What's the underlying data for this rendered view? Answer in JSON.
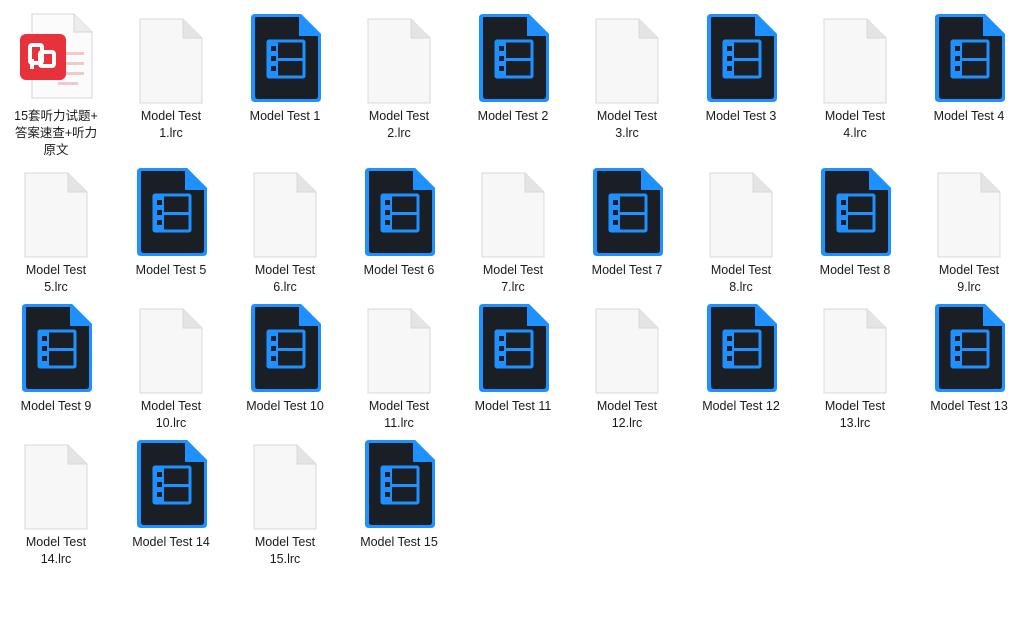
{
  "items": [
    {
      "type": "pdf",
      "lines": [
        "15套听力试题+",
        "答案速查+听力",
        "原文"
      ]
    },
    {
      "type": "lrc",
      "lines": [
        "Model Test",
        "1.lrc"
      ]
    },
    {
      "type": "video",
      "lines": [
        "Model Test 1"
      ]
    },
    {
      "type": "lrc",
      "lines": [
        "Model Test",
        "2.lrc"
      ]
    },
    {
      "type": "video",
      "lines": [
        "Model Test 2"
      ]
    },
    {
      "type": "lrc",
      "lines": [
        "Model Test",
        "3.lrc"
      ]
    },
    {
      "type": "video",
      "lines": [
        "Model Test 3"
      ]
    },
    {
      "type": "lrc",
      "lines": [
        "Model Test",
        "4.lrc"
      ]
    },
    {
      "type": "video",
      "lines": [
        "Model Test 4"
      ]
    },
    {
      "type": "lrc",
      "lines": [
        "Model Test",
        "5.lrc"
      ]
    },
    {
      "type": "video",
      "lines": [
        "Model Test 5"
      ]
    },
    {
      "type": "lrc",
      "lines": [
        "Model Test",
        "6.lrc"
      ]
    },
    {
      "type": "video",
      "lines": [
        "Model Test 6"
      ]
    },
    {
      "type": "lrc",
      "lines": [
        "Model Test",
        "7.lrc"
      ]
    },
    {
      "type": "video",
      "lines": [
        "Model Test 7"
      ]
    },
    {
      "type": "lrc",
      "lines": [
        "Model Test",
        "8.lrc"
      ]
    },
    {
      "type": "video",
      "lines": [
        "Model Test 8"
      ]
    },
    {
      "type": "lrc",
      "lines": [
        "Model Test",
        "9.lrc"
      ]
    },
    {
      "type": "video",
      "lines": [
        "Model Test 9"
      ]
    },
    {
      "type": "lrc",
      "lines": [
        "Model Test",
        "10.lrc"
      ]
    },
    {
      "type": "video",
      "lines": [
        "Model Test 10"
      ]
    },
    {
      "type": "lrc",
      "lines": [
        "Model Test",
        "11.lrc"
      ]
    },
    {
      "type": "video",
      "lines": [
        "Model Test 11"
      ]
    },
    {
      "type": "lrc",
      "lines": [
        "Model Test",
        "12.lrc"
      ]
    },
    {
      "type": "video",
      "lines": [
        "Model Test 12"
      ]
    },
    {
      "type": "lrc",
      "lines": [
        "Model Test",
        "13.lrc"
      ]
    },
    {
      "type": "video",
      "lines": [
        "Model Test 13"
      ]
    },
    {
      "type": "lrc",
      "lines": [
        "Model Test",
        "14.lrc"
      ]
    },
    {
      "type": "video",
      "lines": [
        "Model Test 14"
      ]
    },
    {
      "type": "lrc",
      "lines": [
        "Model Test",
        "15.lrc"
      ]
    },
    {
      "type": "video",
      "lines": [
        "Model Test 15"
      ]
    }
  ],
  "icons": {
    "pdf": "pdf-file-icon",
    "lrc": "blank-document-icon",
    "video": "video-file-icon"
  },
  "colors": {
    "pdf_red": "#e8323b",
    "video_blue": "#1e90ff",
    "video_dark": "#1a1f26",
    "doc_fold": "#e2e2e2"
  }
}
